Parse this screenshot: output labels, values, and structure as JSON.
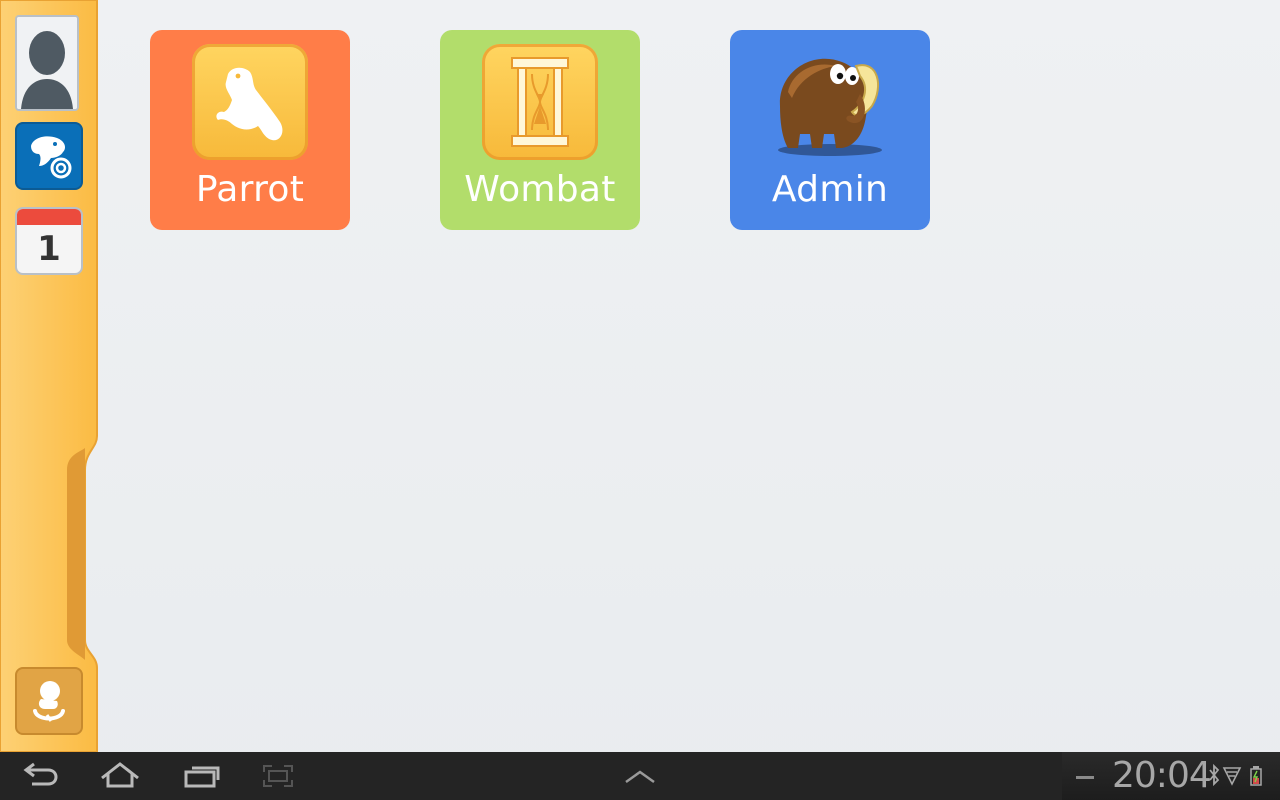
{
  "apps": [
    {
      "label": "Parrot",
      "icon": "parrot-icon",
      "color": "#ff7d48"
    },
    {
      "label": "Wombat",
      "icon": "hourglass-icon",
      "color": "#b2dd6b"
    },
    {
      "label": "Admin",
      "icon": "mammoth-icon",
      "color": "#4a86e8"
    }
  ],
  "sidebar": {
    "items": [
      {
        "name": "profile",
        "icon": "user-silhouette-icon"
      },
      {
        "name": "parrot-shortcut",
        "icon": "parrot-icon"
      },
      {
        "name": "calendar",
        "icon": "calendar-icon",
        "day": "1"
      },
      {
        "name": "voice",
        "icon": "voice-icon"
      }
    ],
    "color": "#fcc34c"
  },
  "navbar": {
    "buttons": [
      "back-icon",
      "home-icon",
      "recent-apps-icon",
      "screenshot-icon",
      "chevron-up-icon"
    ],
    "clock": "20:04",
    "status_icons": [
      "minus-icon",
      "bluetooth-icon",
      "wifi-icon",
      "battery-icon"
    ]
  }
}
